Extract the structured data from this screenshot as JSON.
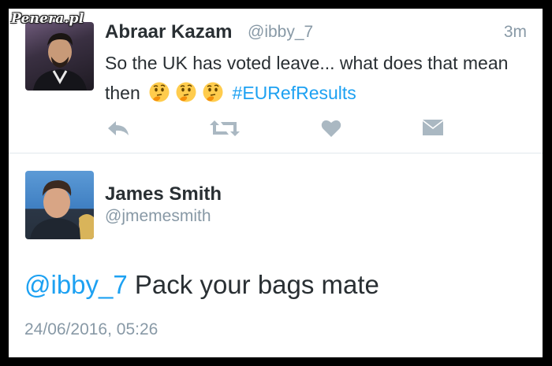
{
  "watermark": "Penera.pl",
  "tweet": {
    "name": "Abraar Kazam",
    "handle": "@ibby_7",
    "time": "3m",
    "text_before": "So the UK has voted leave... what does that mean then",
    "emojis": [
      "thinking-face",
      "thinking-face",
      "thinking-face"
    ],
    "hashtag": "#EURefResults",
    "actions": [
      "reply-icon",
      "retweet-icon",
      "like-icon",
      "message-icon"
    ]
  },
  "reply": {
    "name": "James Smith",
    "handle": "@jmemesmith",
    "mention": "@ibby_7",
    "text": " Pack your bags mate",
    "timestamp": "24/06/2016, 05:26"
  },
  "colors": {
    "link": "#1da1f2",
    "muted": "#8899a6",
    "text": "#292f33",
    "icon": "#aab8c2"
  }
}
